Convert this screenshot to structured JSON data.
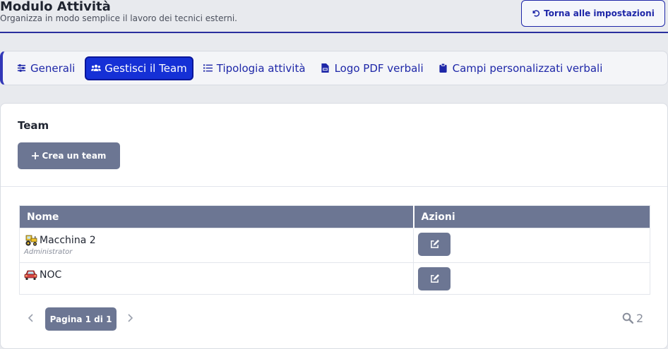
{
  "header": {
    "title": "Modulo Attività",
    "subtitle": "Organizza in modo semplice il lavoro dei tecnici esterni.",
    "back_label": "Torna alle impostazioni"
  },
  "tabs": [
    {
      "label": "Generali",
      "icon": "sliders-icon",
      "active": false
    },
    {
      "label": "Gestisci il Team",
      "icon": "users-icon",
      "active": true
    },
    {
      "label": "Tipologia attività",
      "icon": "list-icon",
      "active": false
    },
    {
      "label": "Logo PDF verbali",
      "icon": "file-pdf-icon",
      "active": false
    },
    {
      "label": "Campi personalizzati verbali",
      "icon": "clipboard-icon",
      "active": false
    }
  ],
  "team": {
    "title": "Team",
    "create_label": "Crea un team",
    "columns": [
      "Nome",
      "Azioni"
    ],
    "rows": [
      {
        "name": "Macchina 2",
        "role": "Administrator",
        "icon": "tractor-icon"
      },
      {
        "name": "NOC",
        "role": "",
        "icon": "car-icon"
      }
    ]
  },
  "pagination": {
    "label": "Pagina 1 di 1",
    "result_count": "2"
  },
  "colors": {
    "accent": "#1e27a8",
    "active_tab": "#1530d6",
    "button_gray": "#6c7693"
  }
}
